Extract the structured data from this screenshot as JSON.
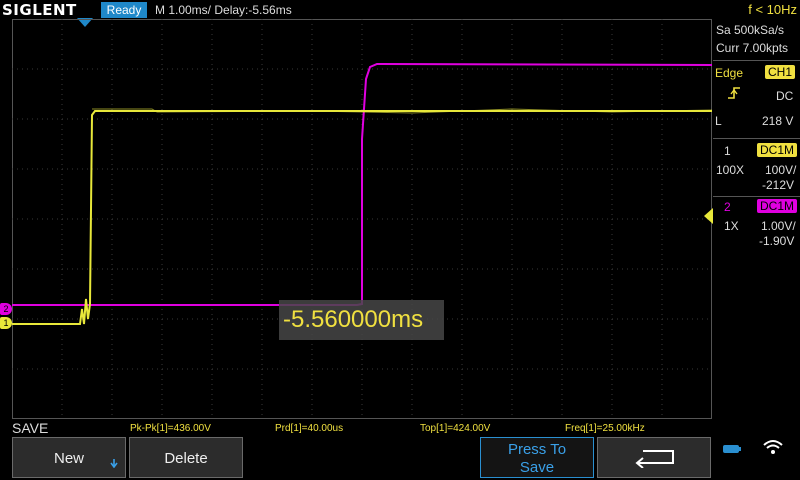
{
  "top_bar": {
    "logo": "SIGLENT",
    "status": "Ready",
    "timebase": "M 1.00ms/ Delay:-5.56ms",
    "trigger_freq": "f < 10Hz"
  },
  "acquisition": {
    "sample_rate": "Sa 500kSa/s",
    "memory_depth": "Curr 7.00kpts"
  },
  "trigger": {
    "type": "Edge",
    "source": "CH1",
    "coupling": "DC",
    "slope_icon": "rising-edge-icon",
    "level_label": "L",
    "level": "218 V"
  },
  "channels": [
    {
      "number": "1",
      "coupling": "DC1M",
      "probe": "100X",
      "scale": "100V/",
      "offset": "-212V",
      "color": "#f0e040"
    },
    {
      "number": "2",
      "coupling": "DC1M",
      "probe": "1X",
      "scale": "1.00V/",
      "offset": "-1.90V",
      "color": "#e000e0"
    }
  ],
  "waveform": {
    "ch1_color": "#e8e83a",
    "ch2_color": "#e000e0",
    "ch1_marker": "1",
    "ch2_marker": "2"
  },
  "delay_readout": "-5.560000ms",
  "measurements": {
    "mode_label": "SAVE",
    "items": [
      "Pk-Pk[1]=436.00V",
      "Prd[1]=40.00us",
      "Top[1]=424.00V",
      "Freq[1]=25.00kHz"
    ]
  },
  "softkeys": {
    "new_label": "New",
    "delete_label": "Delete",
    "press_to_save_line1": "Press To",
    "press_to_save_line2": "Save",
    "back_icon": "return-arrow-icon"
  },
  "status_icons": [
    "usb-icon",
    "wifi-icon"
  ]
}
